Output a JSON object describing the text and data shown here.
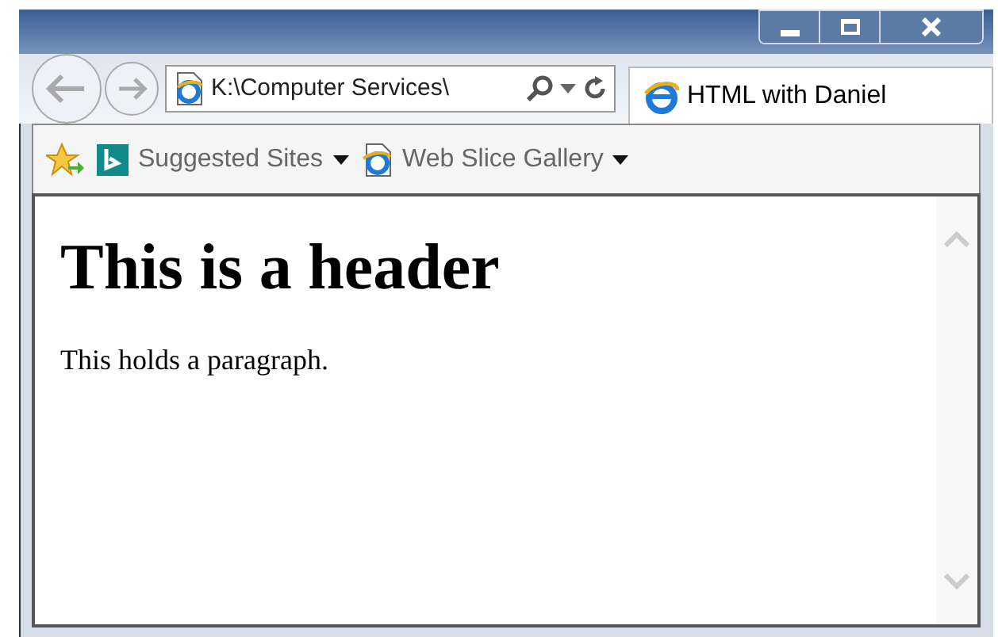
{
  "address_bar": {
    "value": "K:\\Computer Services\\"
  },
  "tab": {
    "title": "HTML with Daniel",
    "selected": true
  },
  "favorites_bar": {
    "items": [
      {
        "label": "Suggested Sites",
        "kind": "bing"
      },
      {
        "label": "Web Slice Gallery",
        "kind": "ie"
      }
    ]
  },
  "page": {
    "heading": "This is a header",
    "paragraph": "This holds a paragraph."
  }
}
